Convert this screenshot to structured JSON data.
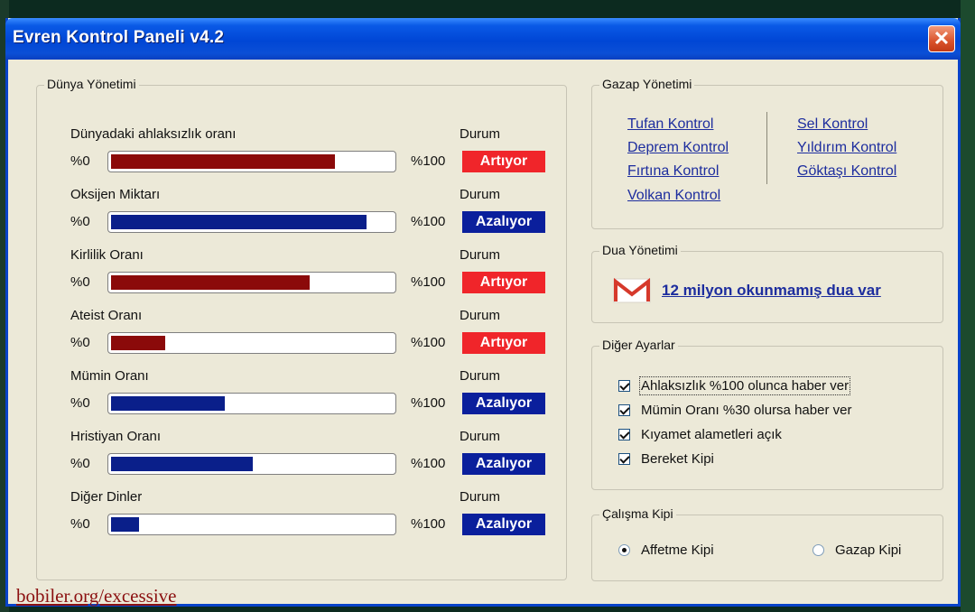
{
  "window": {
    "title": "Evren Kontrol Paneli v4.2",
    "close_glyph": "✕"
  },
  "world": {
    "legend": "Dünya Yönetimi",
    "min_label": "%0",
    "max_label": "%100",
    "durum_label": "Durum",
    "rows": [
      {
        "label": "Dünyadaki ahlaksızlık oranı",
        "level": 0.79,
        "bar_color": "#8b0a0a",
        "status": "Artıyor",
        "status_color": "#f0252a"
      },
      {
        "label": "Oksijen Miktarı",
        "level": 0.9,
        "bar_color": "#0a1f8a",
        "status": "Azalıyor",
        "status_color": "#0a1f9c"
      },
      {
        "label": "Kirlilik Oranı",
        "level": 0.7,
        "bar_color": "#8b0a0a",
        "status": "Artıyor",
        "status_color": "#f0252a"
      },
      {
        "label": "Ateist Oranı",
        "level": 0.19,
        "bar_color": "#8b0a0a",
        "status": "Artıyor",
        "status_color": "#f0252a"
      },
      {
        "label": "Mümin Oranı",
        "level": 0.4,
        "bar_color": "#0a1f8a",
        "status": "Azalıyor",
        "status_color": "#0a1f9c"
      },
      {
        "label": "Hristiyan Oranı",
        "level": 0.5,
        "bar_color": "#0a1f8a",
        "status": "Azalıyor",
        "status_color": "#0a1f9c"
      },
      {
        "label": "Diğer Dinler",
        "level": 0.1,
        "bar_color": "#0a1f8a",
        "status": "Azalıyor",
        "status_color": "#0a1f9c"
      }
    ]
  },
  "wrath": {
    "legend": "Gazap Yönetimi",
    "left_links": [
      "Tufan Kontrol",
      "Deprem Kontrol",
      "Fırtına Kontrol",
      "Volkan Kontrol"
    ],
    "right_links": [
      "Sel Kontrol",
      "Yıldırım Kontrol",
      "Göktaşı Kontrol"
    ]
  },
  "prayer": {
    "legend": "Dua Yönetimi",
    "icon": "gmail-icon",
    "link": "12 milyon okunmamış dua var"
  },
  "other": {
    "legend": "Diğer Ayarlar",
    "items": [
      {
        "label": "Ahlaksızlık %100 olunca haber ver",
        "checked": true
      },
      {
        "label": "Mümin Oranı %30 olursa haber ver",
        "checked": true
      },
      {
        "label": "Kıyamet alametleri açık",
        "checked": true
      },
      {
        "label": "Bereket Kipi",
        "checked": true
      }
    ]
  },
  "mode": {
    "legend": "Çalışma Kipi",
    "options": [
      {
        "label": "Affetme Kipi",
        "selected": true
      },
      {
        "label": "Gazap Kipi",
        "selected": false
      }
    ]
  },
  "watermark": "bobiler.org/excessive"
}
